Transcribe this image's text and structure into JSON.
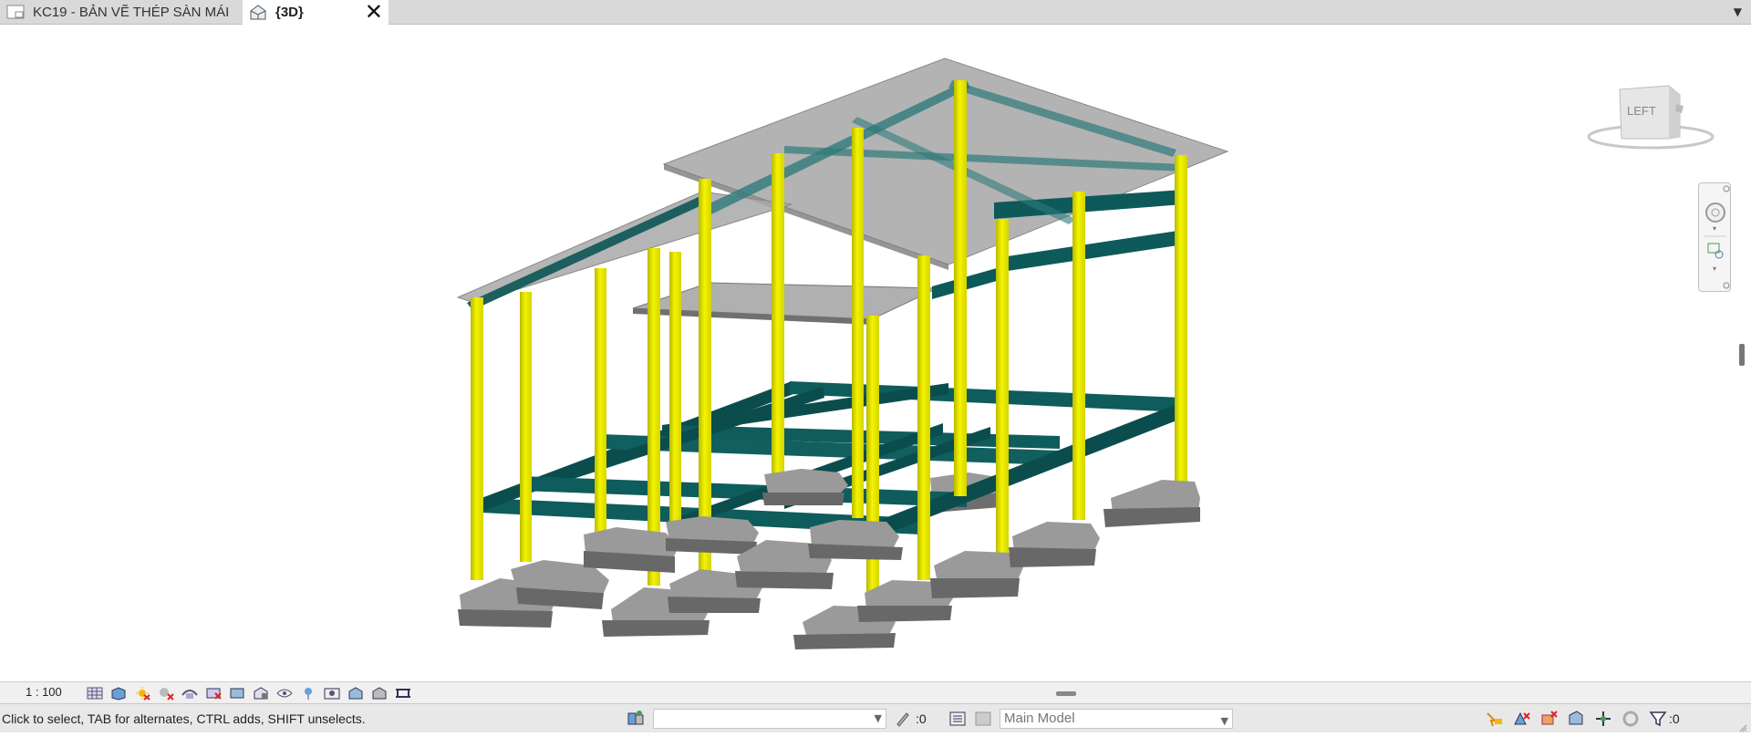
{
  "tabs": [
    {
      "label": "KC19 - BẢN VẼ THÉP SÀN MÁI",
      "active": false
    },
    {
      "label": "{3D}",
      "active": true
    }
  ],
  "viewcube": {
    "face_label": "LEFT"
  },
  "view_control": {
    "scale": "1 : 100"
  },
  "status": {
    "message": "Click to select, TAB for alternates, CTRL adds, SHIFT unselects.",
    "workset_value": "",
    "editable_count": ":0",
    "design_option": "Main Model",
    "filter_count": ":0"
  },
  "colors": {
    "column": "#f2f200",
    "beam": "#0e5a5a",
    "footing": "#8c8c8c",
    "slab": "#b4b4b4"
  }
}
